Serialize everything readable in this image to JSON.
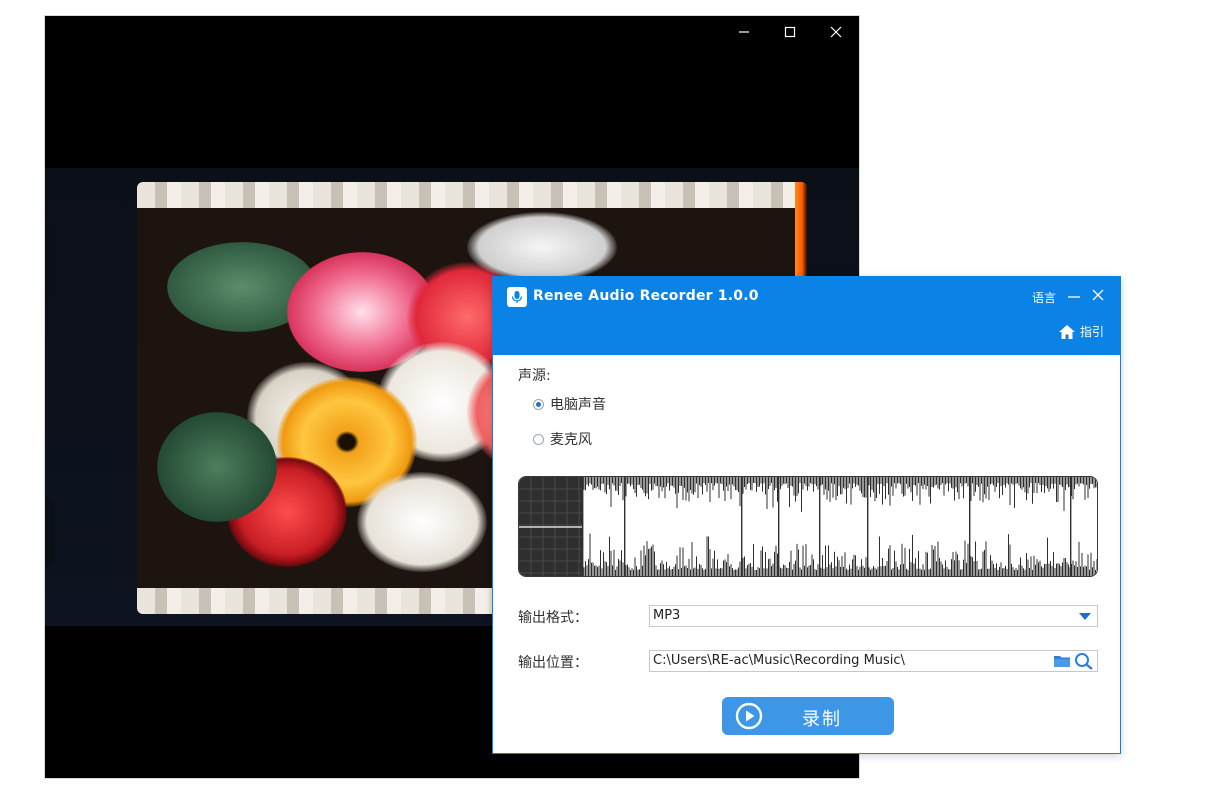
{
  "recorder": {
    "title": "Renee Audio Recorder 1.0.0",
    "language_label": "语言",
    "guide_label": "指引",
    "source_label": "声源:",
    "sources": [
      {
        "label": "电脑声音",
        "selected": true
      },
      {
        "label": "麦克风",
        "selected": false
      }
    ],
    "output_format_label": "输出格式：",
    "output_format_value": "MP3",
    "output_location_label": "输出位置：",
    "output_location_value": "C:\\Users\\RE-ac\\Music\\Recording Music\\",
    "record_label": "录制"
  },
  "colors": {
    "accent": "#0a82e6",
    "button": "#3d97e6",
    "waveform": "#2f2f2f"
  },
  "icons": {
    "app": "microphone-icon",
    "home": "home-icon",
    "folder": "folder-icon",
    "search": "search-icon",
    "play": "play-circle-icon"
  }
}
